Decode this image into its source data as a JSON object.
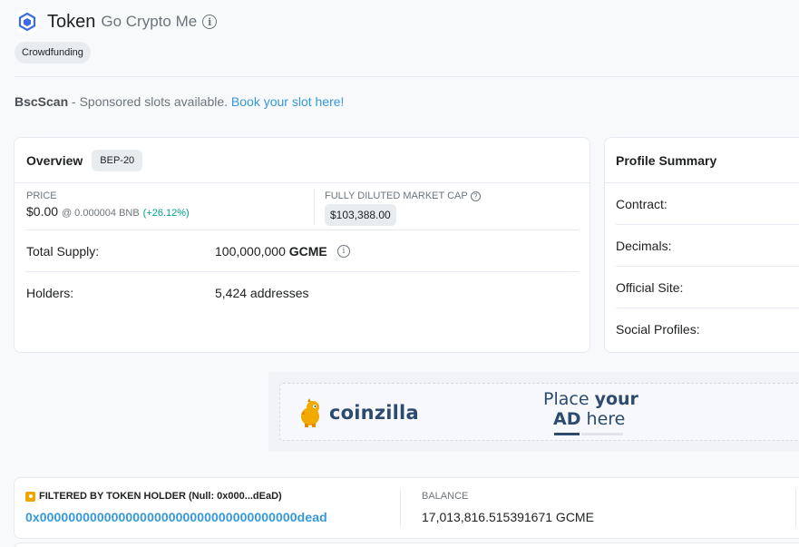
{
  "header": {
    "title": "Token",
    "subtitle": "Go Crypto Me",
    "info_icon": "info-circle-icon",
    "tag": "Crowdfunding"
  },
  "sponsor": {
    "brand": "BscScan",
    "text": " - Sponsored slots available. ",
    "link": "Book your slot here!"
  },
  "overview": {
    "title": "Overview",
    "badge": "BEP-20",
    "price_label": "PRICE",
    "price_value": "$0.00",
    "price_bnb": "@ 0.000004 BNB",
    "price_change": "(+26.12%)",
    "mcap_label": "FULLY DILUTED MARKET CAP",
    "mcap_value": "$103,388.00",
    "supply_label": "Total Supply:",
    "supply_value": "100,000,000",
    "supply_symbol": "GCME",
    "holders_label": "Holders:",
    "holders_value": "5,424 addresses"
  },
  "profile": {
    "title": "Profile Summary",
    "rows": [
      "Contract:",
      "Decimals:",
      "Official Site:",
      "Social Profiles:"
    ]
  },
  "ad": {
    "brand": "coinzilla",
    "place_line1_a": "Place ",
    "place_line1_b": "your",
    "place_line2_a": "AD",
    "place_line2_b": " here"
  },
  "filter": {
    "label": "FILTERED BY TOKEN HOLDER (Null: 0x000...dEaD)",
    "address": "0x000000000000000000000000000000000000dead",
    "balance_label": "BALANCE",
    "balance_value": "17,013,816.515391671 GCME"
  },
  "colors": {
    "accent": "#3498db",
    "positive": "#00a186",
    "logo_blue": "#3c6de0",
    "holder_icon": "#f0a500"
  }
}
